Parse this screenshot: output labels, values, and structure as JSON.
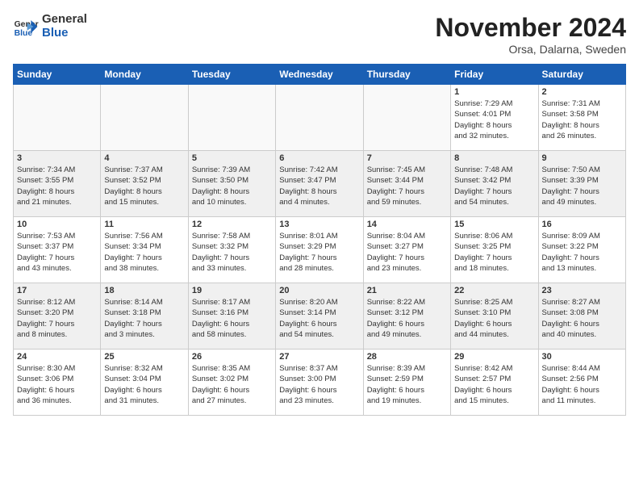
{
  "header": {
    "logo_general": "General",
    "logo_blue": "Blue",
    "month_title": "November 2024",
    "location": "Orsa, Dalarna, Sweden"
  },
  "weekdays": [
    "Sunday",
    "Monday",
    "Tuesday",
    "Wednesday",
    "Thursday",
    "Friday",
    "Saturday"
  ],
  "weeks": [
    [
      {
        "day": "",
        "info": ""
      },
      {
        "day": "",
        "info": ""
      },
      {
        "day": "",
        "info": ""
      },
      {
        "day": "",
        "info": ""
      },
      {
        "day": "",
        "info": ""
      },
      {
        "day": "1",
        "info": "Sunrise: 7:29 AM\nSunset: 4:01 PM\nDaylight: 8 hours\nand 32 minutes."
      },
      {
        "day": "2",
        "info": "Sunrise: 7:31 AM\nSunset: 3:58 PM\nDaylight: 8 hours\nand 26 minutes."
      }
    ],
    [
      {
        "day": "3",
        "info": "Sunrise: 7:34 AM\nSunset: 3:55 PM\nDaylight: 8 hours\nand 21 minutes."
      },
      {
        "day": "4",
        "info": "Sunrise: 7:37 AM\nSunset: 3:52 PM\nDaylight: 8 hours\nand 15 minutes."
      },
      {
        "day": "5",
        "info": "Sunrise: 7:39 AM\nSunset: 3:50 PM\nDaylight: 8 hours\nand 10 minutes."
      },
      {
        "day": "6",
        "info": "Sunrise: 7:42 AM\nSunset: 3:47 PM\nDaylight: 8 hours\nand 4 minutes."
      },
      {
        "day": "7",
        "info": "Sunrise: 7:45 AM\nSunset: 3:44 PM\nDaylight: 7 hours\nand 59 minutes."
      },
      {
        "day": "8",
        "info": "Sunrise: 7:48 AM\nSunset: 3:42 PM\nDaylight: 7 hours\nand 54 minutes."
      },
      {
        "day": "9",
        "info": "Sunrise: 7:50 AM\nSunset: 3:39 PM\nDaylight: 7 hours\nand 49 minutes."
      }
    ],
    [
      {
        "day": "10",
        "info": "Sunrise: 7:53 AM\nSunset: 3:37 PM\nDaylight: 7 hours\nand 43 minutes."
      },
      {
        "day": "11",
        "info": "Sunrise: 7:56 AM\nSunset: 3:34 PM\nDaylight: 7 hours\nand 38 minutes."
      },
      {
        "day": "12",
        "info": "Sunrise: 7:58 AM\nSunset: 3:32 PM\nDaylight: 7 hours\nand 33 minutes."
      },
      {
        "day": "13",
        "info": "Sunrise: 8:01 AM\nSunset: 3:29 PM\nDaylight: 7 hours\nand 28 minutes."
      },
      {
        "day": "14",
        "info": "Sunrise: 8:04 AM\nSunset: 3:27 PM\nDaylight: 7 hours\nand 23 minutes."
      },
      {
        "day": "15",
        "info": "Sunrise: 8:06 AM\nSunset: 3:25 PM\nDaylight: 7 hours\nand 18 minutes."
      },
      {
        "day": "16",
        "info": "Sunrise: 8:09 AM\nSunset: 3:22 PM\nDaylight: 7 hours\nand 13 minutes."
      }
    ],
    [
      {
        "day": "17",
        "info": "Sunrise: 8:12 AM\nSunset: 3:20 PM\nDaylight: 7 hours\nand 8 minutes."
      },
      {
        "day": "18",
        "info": "Sunrise: 8:14 AM\nSunset: 3:18 PM\nDaylight: 7 hours\nand 3 minutes."
      },
      {
        "day": "19",
        "info": "Sunrise: 8:17 AM\nSunset: 3:16 PM\nDaylight: 6 hours\nand 58 minutes."
      },
      {
        "day": "20",
        "info": "Sunrise: 8:20 AM\nSunset: 3:14 PM\nDaylight: 6 hours\nand 54 minutes."
      },
      {
        "day": "21",
        "info": "Sunrise: 8:22 AM\nSunset: 3:12 PM\nDaylight: 6 hours\nand 49 minutes."
      },
      {
        "day": "22",
        "info": "Sunrise: 8:25 AM\nSunset: 3:10 PM\nDaylight: 6 hours\nand 44 minutes."
      },
      {
        "day": "23",
        "info": "Sunrise: 8:27 AM\nSunset: 3:08 PM\nDaylight: 6 hours\nand 40 minutes."
      }
    ],
    [
      {
        "day": "24",
        "info": "Sunrise: 8:30 AM\nSunset: 3:06 PM\nDaylight: 6 hours\nand 36 minutes."
      },
      {
        "day": "25",
        "info": "Sunrise: 8:32 AM\nSunset: 3:04 PM\nDaylight: 6 hours\nand 31 minutes."
      },
      {
        "day": "26",
        "info": "Sunrise: 8:35 AM\nSunset: 3:02 PM\nDaylight: 6 hours\nand 27 minutes."
      },
      {
        "day": "27",
        "info": "Sunrise: 8:37 AM\nSunset: 3:00 PM\nDaylight: 6 hours\nand 23 minutes."
      },
      {
        "day": "28",
        "info": "Sunrise: 8:39 AM\nSunset: 2:59 PM\nDaylight: 6 hours\nand 19 minutes."
      },
      {
        "day": "29",
        "info": "Sunrise: 8:42 AM\nSunset: 2:57 PM\nDaylight: 6 hours\nand 15 minutes."
      },
      {
        "day": "30",
        "info": "Sunrise: 8:44 AM\nSunset: 2:56 PM\nDaylight: 6 hours\nand 11 minutes."
      }
    ]
  ]
}
